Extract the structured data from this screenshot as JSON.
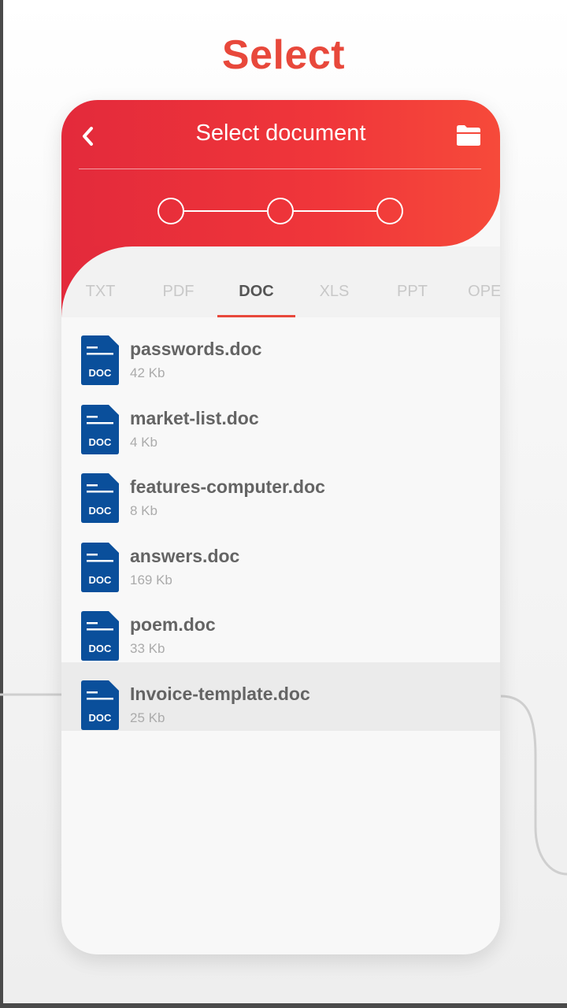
{
  "headline": "Select",
  "header": {
    "title": "Select document",
    "back_icon": "chevron-left-icon",
    "folder_icon": "folder-icon"
  },
  "stepper": {
    "current_step": 1,
    "total_steps": 3
  },
  "tabs": [
    {
      "label": "TXT",
      "active": false
    },
    {
      "label": "PDF",
      "active": false
    },
    {
      "label": "DOC",
      "active": true
    },
    {
      "label": "XLS",
      "active": false
    },
    {
      "label": "PPT",
      "active": false
    },
    {
      "label": "OPEN",
      "active": false
    }
  ],
  "files": [
    {
      "name": "passwords.doc",
      "size": "42 Kb",
      "highlighted": false
    },
    {
      "name": "market-list.doc",
      "size": "4 Kb",
      "highlighted": false
    },
    {
      "name": "features-computer.doc",
      "size": "8 Kb",
      "highlighted": false
    },
    {
      "name": "answers.doc",
      "size": "169 Kb",
      "highlighted": false
    },
    {
      "name": "poem.doc",
      "size": "33 Kb",
      "highlighted": false
    },
    {
      "name": "Invoice-template.doc",
      "size": "25 Kb",
      "highlighted": true
    }
  ],
  "file_icon": {
    "name": "doc-file-icon",
    "label": "DOC",
    "color": "#0a4f9b"
  },
  "colors": {
    "accent": "#e8483b",
    "header_gradient_start": "#e32a3b",
    "header_gradient_end": "#f64a3a"
  }
}
